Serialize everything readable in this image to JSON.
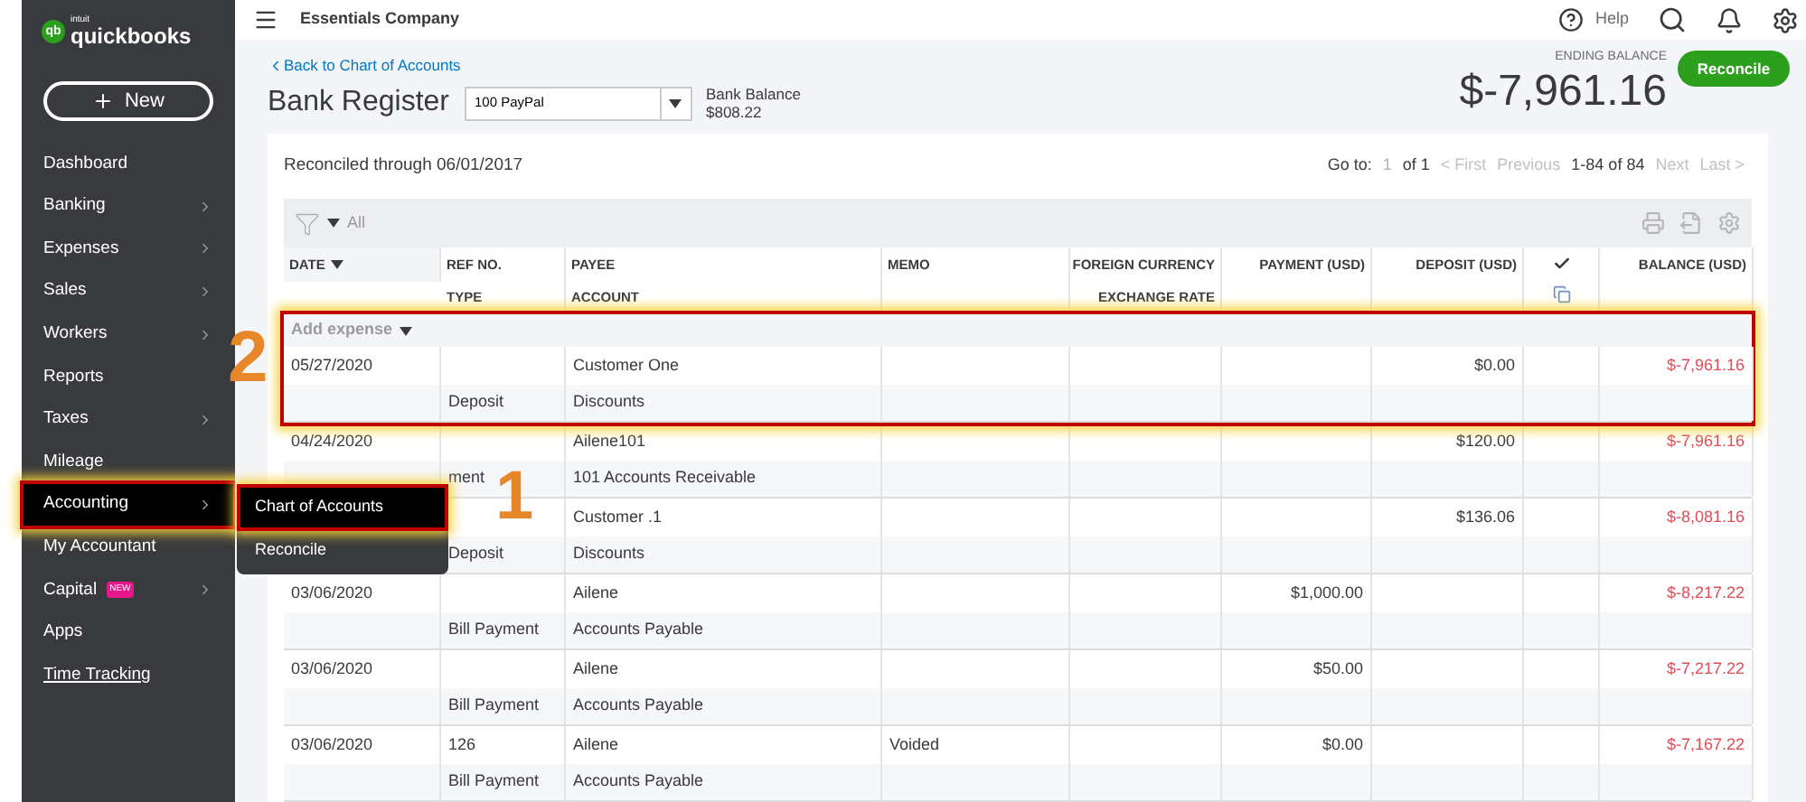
{
  "brand": {
    "badge": "qb",
    "maker": "intuit",
    "name": "quickbooks"
  },
  "new_button": {
    "label": "New"
  },
  "sidebar": {
    "items": [
      {
        "label": "Dashboard",
        "chevron": false,
        "selected": false
      },
      {
        "label": "Banking",
        "chevron": true,
        "selected": false
      },
      {
        "label": "Expenses",
        "chevron": true,
        "selected": false
      },
      {
        "label": "Sales",
        "chevron": true,
        "selected": false
      },
      {
        "label": "Workers",
        "chevron": true,
        "selected": false
      },
      {
        "label": "Reports",
        "chevron": false,
        "selected": false
      },
      {
        "label": "Taxes",
        "chevron": true,
        "selected": false
      },
      {
        "label": "Mileage",
        "chevron": false,
        "selected": false
      },
      {
        "label": "Accounting",
        "chevron": true,
        "selected": true
      },
      {
        "label": "My Accountant",
        "chevron": false,
        "selected": false
      },
      {
        "label": "Capital",
        "chevron": true,
        "selected": false,
        "badge": "NEW"
      },
      {
        "label": "Apps",
        "chevron": false,
        "selected": false
      },
      {
        "label": "Time Tracking",
        "chevron": false,
        "selected": false,
        "kind": "link"
      }
    ]
  },
  "flyout": {
    "callout": "1",
    "items": [
      {
        "label": "Chart of Accounts",
        "selected": true
      },
      {
        "label": "Reconcile",
        "selected": false
      }
    ]
  },
  "top_bar": {
    "company": "Essentials Company",
    "help": "Help"
  },
  "header": {
    "back_link": "Back to Chart of Accounts",
    "title": "Bank Register",
    "account": "100 PayPal",
    "bank_balance_label": "Bank Balance",
    "bank_balance": "$808.22",
    "ending_balance_label": "ENDING BALANCE",
    "ending_balance": "$-7,961.16",
    "reconcile_button": "Reconcile"
  },
  "register": {
    "reconciled": "Reconciled through 06/01/2017",
    "pager": {
      "goto": "Go to:",
      "page": "1",
      "of": "of 1",
      "first": "< First",
      "previous": "Previous",
      "range": "1-84 of 84",
      "next": "Next",
      "last": "Last >"
    },
    "filter": "All",
    "columns": [
      {
        "top": "DATE",
        "sort": true
      },
      {
        "top": "REF NO.",
        "bottom": "TYPE"
      },
      {
        "top": "PAYEE",
        "bottom": "ACCOUNT"
      },
      {
        "top": "MEMO"
      },
      {
        "top": "FOREIGN CURRENCY",
        "bottom": "EXCHANGE RATE"
      },
      {
        "top": "PAYMENT (USD)"
      },
      {
        "top": "DEPOSIT (USD)"
      },
      {
        "kind": "check"
      },
      {
        "top": "BALANCE (USD)"
      }
    ],
    "add_row": {
      "label": "Add expense",
      "callout": "2"
    },
    "rows": [
      {
        "date": "05/27/2020",
        "ref": "",
        "type": "Deposit",
        "payee": "Customer One",
        "account": "Discounts",
        "memo": "",
        "payment": "",
        "deposit": "$0.00",
        "balance": "$-7,961.16"
      },
      {
        "date": "04/24/2020",
        "ref": "",
        "type": "ment",
        "payee": "Ailene101",
        "account": "101 Accounts Receivable",
        "memo": "",
        "payment": "",
        "deposit": "$120.00",
        "balance": "$-7,961.16"
      },
      {
        "date": "",
        "ref": "",
        "type": "Deposit",
        "payee": "Customer .1",
        "account": "Discounts",
        "memo": "",
        "payment": "",
        "deposit": "$136.06",
        "balance": "$-8,081.16"
      },
      {
        "date": "03/06/2020",
        "ref": "",
        "type": "Bill Payment",
        "payee": "Ailene",
        "account": "Accounts Payable",
        "memo": "",
        "payment": "$1,000.00",
        "deposit": "",
        "balance": "$-8,217.22"
      },
      {
        "date": "03/06/2020",
        "ref": "",
        "type": "Bill Payment",
        "payee": "Ailene",
        "account": "Accounts Payable",
        "memo": "",
        "payment": "$50.00",
        "deposit": "",
        "balance": "$-7,217.22"
      },
      {
        "date": "03/06/2020",
        "ref": "126",
        "type": "Bill Payment",
        "payee": "Ailene",
        "account": "Accounts Payable",
        "memo": "Voided",
        "payment": "$0.00",
        "deposit": "",
        "balance": "$-7,167.22"
      }
    ]
  }
}
